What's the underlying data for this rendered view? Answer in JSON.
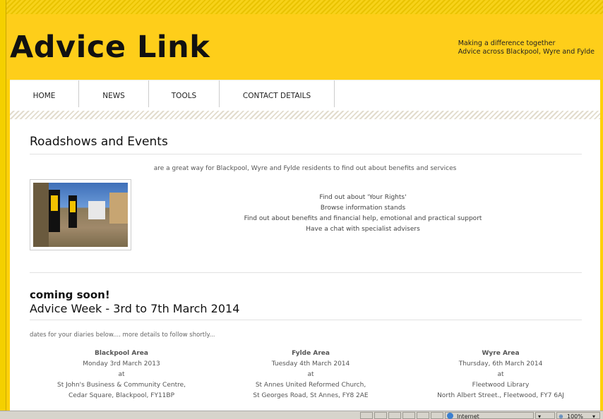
{
  "header": {
    "logo": "Advice Link",
    "tagline_1": "Making a difference together",
    "tagline_2": "Advice across Blackpool, Wyre and Fylde"
  },
  "nav": {
    "items": [
      "HOME",
      "NEWS",
      "TOOLS",
      "CONTACT DETAILS"
    ]
  },
  "roadshows": {
    "title": "Roadshows and Events",
    "intro": "are a great way for Blackpool, Wyre and Fylde residents to find out about benefits and services",
    "points": [
      "Find out about 'Your Rights'",
      "Browse information stands",
      "Find out about benefits and financial help, emotional and practical support",
      "Have a chat with specialist advisers"
    ]
  },
  "advice_week": {
    "coming_soon": "coming soon!",
    "title": "Advice Week - 3rd to 7th March 2014",
    "diaries": "dates for your diaries below.... more details to follow shortly...",
    "areas": [
      {
        "name": "Blackpool Area",
        "date": "Monday 3rd March 2013",
        "at": "at",
        "venue": "St John's Business & Community Centre,",
        "address": "Cedar Square, Blackpool, FY11BP"
      },
      {
        "name": "Fylde Area",
        "date": "Tuesday 4th March 2014",
        "at": "at",
        "venue": "St Annes United Reformed Church,",
        "address": "St Georges Road, St Annes, FY8 2AE"
      },
      {
        "name": "Wyre Area",
        "date": "Thursday, 6th March 2014",
        "at": "at",
        "venue": "Fleetwood Library",
        "address": "North Albert Street., Fleetwood,  FY7 6AJ"
      }
    ]
  },
  "statusbar": {
    "zone": "Internet",
    "zoom": "100%"
  },
  "colors": {
    "brand_yellow": "#fece1a",
    "text_dark": "#111111"
  }
}
